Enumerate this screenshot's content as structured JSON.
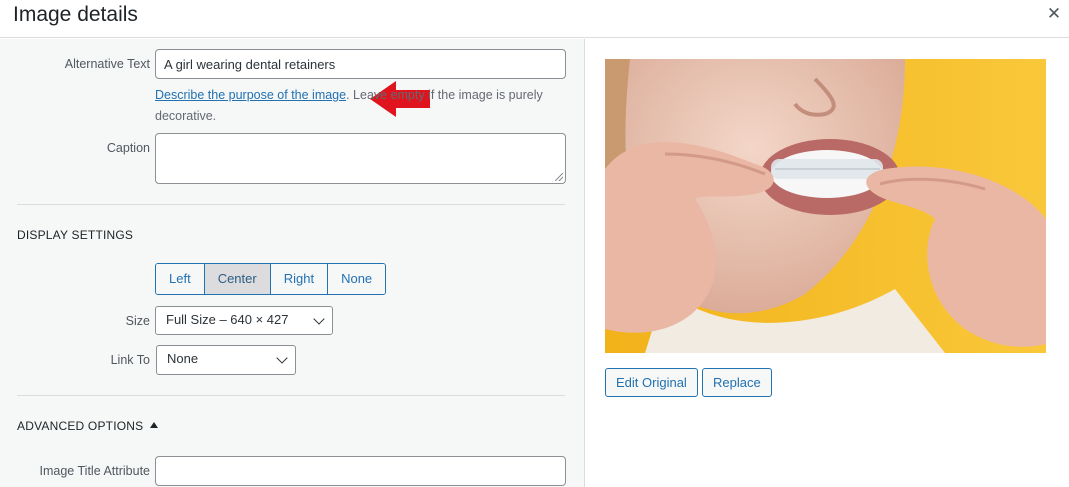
{
  "dialog": {
    "title": "Image details",
    "close_glyph": "✕",
    "close_icon": "close-icon"
  },
  "fields": {
    "alt_text": {
      "label": "Alternative Text",
      "value": "A girl wearing dental retainers"
    },
    "alt_help": {
      "link": "Describe the purpose of the image",
      "rest": ". Leave empty if the image is purely decorative."
    },
    "caption": {
      "label": "Caption",
      "value": ""
    }
  },
  "display_settings": {
    "heading": "DISPLAY SETTINGS",
    "align": {
      "options": [
        "Left",
        "Center",
        "Right",
        "None"
      ],
      "selected": "Center"
    },
    "size": {
      "label": "Size",
      "value": "Full Size – 640 × 427"
    },
    "link_to": {
      "label": "Link To",
      "value": "None"
    }
  },
  "advanced": {
    "heading": "ADVANCED OPTIONS",
    "expanded": true,
    "title_attr": {
      "label": "Image Title Attribute",
      "value": ""
    }
  },
  "preview": {
    "image_icon": "image-preview",
    "buttons": {
      "edit": "Edit Original",
      "replace": "Replace"
    }
  },
  "colors": {
    "accent": "#2271b1",
    "annotation": "#e0141e",
    "preview_bg": "#f7c12a"
  }
}
